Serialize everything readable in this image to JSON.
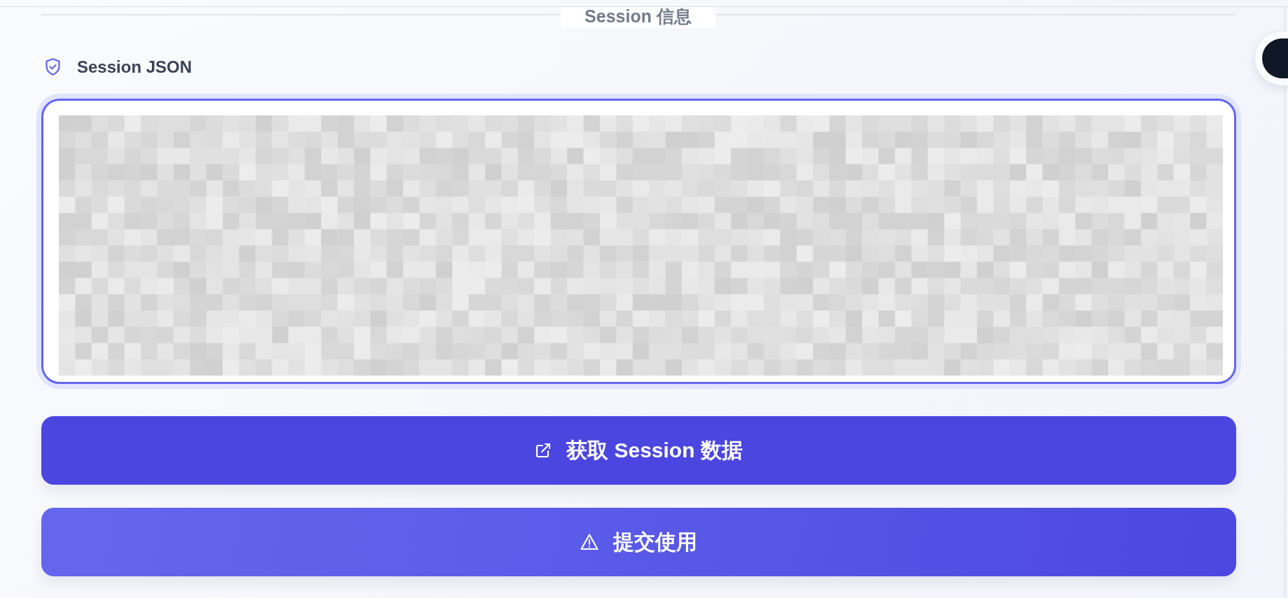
{
  "section": {
    "title": "Session 信息"
  },
  "session_field": {
    "label": "Session JSON"
  },
  "buttons": [
    {
      "label": "获取 Session 数据",
      "kind": "fetch"
    },
    {
      "label": "提交使用",
      "kind": "submit"
    }
  ]
}
